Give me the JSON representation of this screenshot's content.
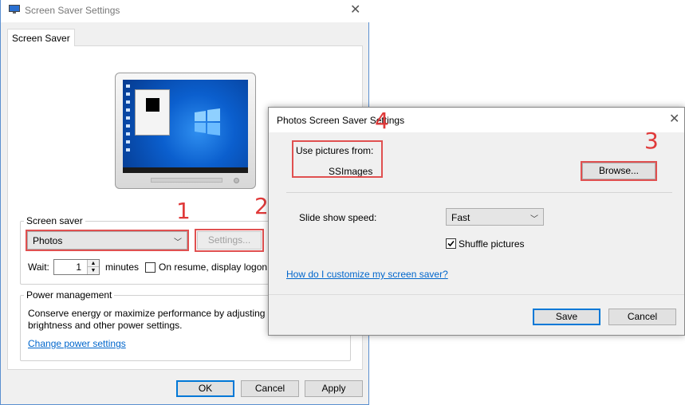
{
  "main_window": {
    "title": "Screen Saver Settings",
    "tab_label": "Screen Saver",
    "screen_saver_group_label": "Screen saver",
    "screen_saver_selected": "Photos",
    "settings_button": "Settings...",
    "wait_label": "Wait:",
    "wait_value": "1",
    "minutes_label": "minutes",
    "on_resume_label": "On resume, display logon s",
    "power_group_label": "Power management",
    "power_text_line1": "Conserve energy or maximize performance by adjusting d",
    "power_text_line2": "brightness and other power settings.",
    "change_power_link": "Change power settings",
    "ok_button": "OK",
    "cancel_button": "Cancel",
    "apply_button": "Apply"
  },
  "photos_dialog": {
    "title": "Photos Screen Saver Settings",
    "use_pictures_label": "Use pictures from:",
    "folder_value": "SSImages",
    "browse_button": "Browse...",
    "slide_speed_label": "Slide show speed:",
    "slide_speed_value": "Fast",
    "shuffle_label": "Shuffle pictures",
    "shuffle_checked": true,
    "help_link": "How do I customize my screen saver?",
    "save_button": "Save",
    "cancel_button": "Cancel"
  },
  "annotations": {
    "marker_1": "1",
    "marker_2": "2",
    "marker_3": "3",
    "marker_4": "4",
    "highlight_color": "#e05050"
  },
  "icons": {
    "app_icon": "monitor-icon",
    "close": "close-icon",
    "dropdown": "chevron-down-icon",
    "checkmark": "checkmark-icon"
  }
}
